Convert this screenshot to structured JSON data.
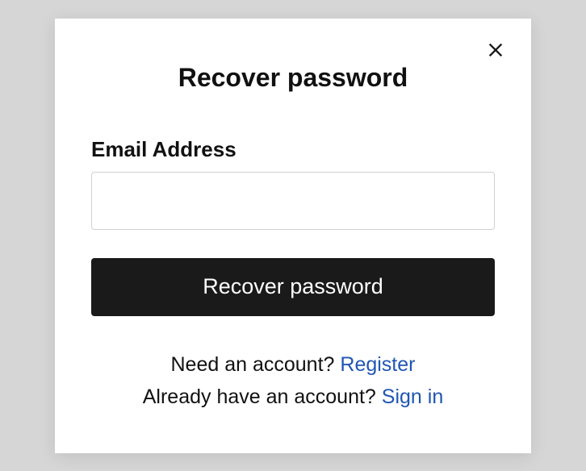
{
  "modal": {
    "title": "Recover password",
    "closeLabel": "Close"
  },
  "form": {
    "emailLabel": "Email Address",
    "emailValue": "",
    "submitLabel": "Recover password"
  },
  "links": {
    "registerPrompt": "Need an account?  ",
    "registerLink": "Register",
    "signinPrompt": "Already have an account?  ",
    "signinLink": "Sign in"
  }
}
